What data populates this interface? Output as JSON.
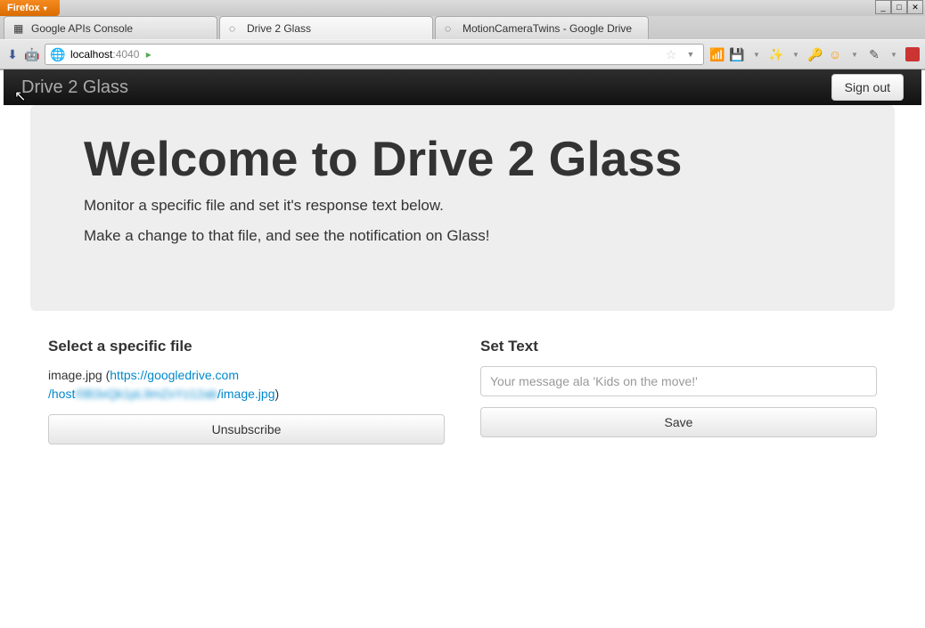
{
  "browser": {
    "menu_label": "Firefox",
    "tabs": [
      {
        "label": "Google APIs Console"
      },
      {
        "label": "Drive 2 Glass"
      },
      {
        "label": "MotionCameraTwins - Google Drive"
      }
    ],
    "url_host": "localhost",
    "url_port": ":4040"
  },
  "app": {
    "brand": "Drive 2 Glass",
    "signout": "Sign out",
    "hero_title": "Welcome to Drive 2 Glass",
    "hero_sub1": "Monitor a specific file and set it's response text below.",
    "hero_sub2": "Make a change to that file, and see the notification on Glass!",
    "left_heading": "Select a specific file",
    "file_name": "image.jpg",
    "file_url_prefix": "https://googledrive.com",
    "file_url_mid": "/host",
    "file_url_blur": "/0B3xQk1pL9mZxYz12ab",
    "file_url_suffix": "/image.jpg",
    "unsubscribe": "Unsubscribe",
    "right_heading": "Set Text",
    "placeholder": "Your message ala 'Kids on the move!'",
    "save": "Save"
  }
}
